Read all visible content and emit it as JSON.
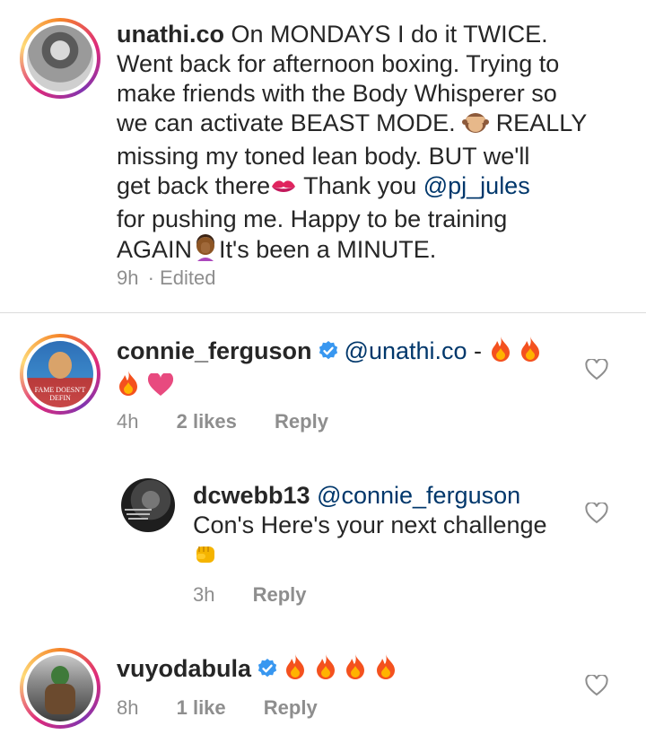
{
  "caption": {
    "username": "unathi.co",
    "lines": [
      "On MONDAYS I do it TWICE.",
      "Went back for afternoon boxing. Trying to",
      "make friends with the Body Whisperer so",
      "we can activate BEAST MODE.",
      "REALLY",
      "missing my toned lean body. BUT we'll",
      "get back there",
      "Thank you",
      "@pj_jules",
      "for pushing me. Happy to be training",
      "AGAIN",
      "It's been a MINUTE."
    ],
    "time": "9h",
    "edited": "· Edited"
  },
  "comments": [
    {
      "username": "connie_ferguson",
      "verified": true,
      "mention": "@unathi.co",
      "text": " - ",
      "time": "4h",
      "likes": "2 likes",
      "reply": "Reply",
      "avatar_text_1": "FAME DOESN'T",
      "avatar_text_2": "DEFIN"
    },
    {
      "username": "dcwebb13",
      "verified": false,
      "mention": "@connie_ferguson",
      "text": "Con's Here's your next challenge",
      "time": "3h",
      "reply": "Reply"
    },
    {
      "username": "vuyodabula",
      "verified": true,
      "time": "8h",
      "likes": "1 like",
      "reply": "Reply"
    }
  ],
  "colors": {
    "text": "#262626",
    "muted": "#8e8e8e",
    "mention": "#00376b",
    "verified": "#3897f0",
    "divider": "#dbdbdb"
  }
}
